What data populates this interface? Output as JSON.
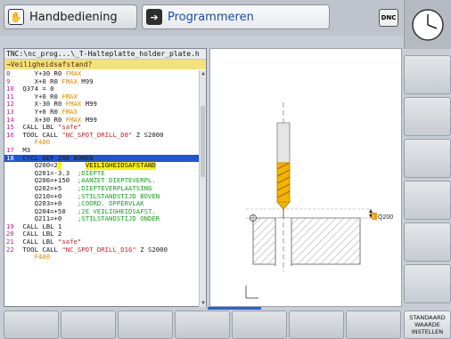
{
  "header": {
    "mode_machine_label": "Handbediening",
    "mode_programming_label": "Programmeren",
    "dnc_label": "DNC"
  },
  "program": {
    "path": "TNC:\\nc_prog...\\_T-Halteplatte_holder_plate.h",
    "hint": "→Veiligheidsafstand?",
    "lines": [
      {
        "n": "8",
        "parts": [
          {
            "t": "    Y+30 R0 ",
            "c": "kw"
          },
          {
            "t": "FMAX",
            "c": "feed"
          }
        ]
      },
      {
        "n": "9",
        "parts": [
          {
            "t": "    X+0 R0 ",
            "c": "kw"
          },
          {
            "t": "FMAX",
            "c": "feed"
          },
          {
            "t": " M99",
            "c": "kw"
          }
        ]
      },
      {
        "n": "10",
        "parts": [
          {
            "t": " Q374 = 0",
            "c": "kw"
          }
        ]
      },
      {
        "n": "11",
        "parts": [
          {
            "t": "    Y+0 R0 ",
            "c": "kw"
          },
          {
            "t": "FMAX",
            "c": "feed"
          }
        ]
      },
      {
        "n": "12",
        "parts": [
          {
            "t": "    X-30 R0 ",
            "c": "kw"
          },
          {
            "t": "FMAX",
            "c": "feed"
          },
          {
            "t": " M99",
            "c": "kw"
          }
        ]
      },
      {
        "n": "13",
        "parts": [
          {
            "t": "    Y+0 R0 ",
            "c": "kw"
          },
          {
            "t": "FMAX",
            "c": "feed"
          }
        ]
      },
      {
        "n": "14",
        "parts": [
          {
            "t": "    X+30 R0 ",
            "c": "kw"
          },
          {
            "t": "FMAX",
            "c": "feed"
          },
          {
            "t": " M99",
            "c": "kw"
          }
        ]
      },
      {
        "n": "15",
        "parts": [
          {
            "t": " CALL LBL ",
            "c": "kw"
          },
          {
            "t": "\"safe\"",
            "c": "str"
          }
        ]
      },
      {
        "n": "16",
        "parts": [
          {
            "t": " TOOL CALL ",
            "c": "kw"
          },
          {
            "t": "\"NC_SPOT_DRILL_D8\"",
            "c": "str"
          },
          {
            "t": " Z S2000",
            "c": "kw"
          }
        ]
      },
      {
        "n": "",
        "parts": [
          {
            "t": "    F400",
            "c": "feed"
          }
        ]
      },
      {
        "n": "17",
        "parts": [
          {
            "t": " M3",
            "c": "kw"
          }
        ]
      },
      {
        "n": "18",
        "sel": true,
        "parts": [
          {
            "t": " CYCL DEF 200 BOREN",
            "c": "kw"
          }
        ]
      },
      {
        "n": "",
        "parts": [
          {
            "t": "    Q200=2",
            "c": "kw"
          },
          {
            "t": " ",
            "c": "hl"
          },
          {
            "t": "      ",
            "c": "kw"
          },
          {
            "t": "VEILIGHEIDSAFSTAND",
            "c": "hl"
          }
        ]
      },
      {
        "n": "",
        "parts": [
          {
            "t": "    Q201=-3.3  ",
            "c": "kw"
          },
          {
            "t": ";DIEPTE",
            "c": "com"
          }
        ]
      },
      {
        "n": "",
        "parts": [
          {
            "t": "    Q206=+150  ",
            "c": "kw"
          },
          {
            "t": ";AANZET DIEPTEVERPL.",
            "c": "com"
          }
        ]
      },
      {
        "n": "",
        "parts": [
          {
            "t": "    Q202=+5    ",
            "c": "kw"
          },
          {
            "t": ";DIEPTEVERPLAATSING",
            "c": "com"
          }
        ]
      },
      {
        "n": "",
        "parts": [
          {
            "t": "    Q210=+0    ",
            "c": "kw"
          },
          {
            "t": ";STILSTANDSTIJD BOVEN",
            "c": "com"
          }
        ]
      },
      {
        "n": "",
        "parts": [
          {
            "t": "    Q203=+0    ",
            "c": "kw"
          },
          {
            "t": ";COORD. OPPERVLAK",
            "c": "com"
          }
        ]
      },
      {
        "n": "",
        "parts": [
          {
            "t": "    Q204=+50   ",
            "c": "kw"
          },
          {
            "t": ";2E VEILIGHEIDSAFST.",
            "c": "com"
          }
        ]
      },
      {
        "n": "",
        "parts": [
          {
            "t": "    Q211=+0    ",
            "c": "kw"
          },
          {
            "t": ";STILSTANDSTIJD ONDER",
            "c": "com"
          }
        ]
      },
      {
        "n": "19",
        "parts": [
          {
            "t": " CALL LBL 1",
            "c": "kw"
          }
        ]
      },
      {
        "n": "20",
        "parts": [
          {
            "t": " CALL LBL 2",
            "c": "kw"
          }
        ]
      },
      {
        "n": "21",
        "parts": [
          {
            "t": " CALL LBL ",
            "c": "kw"
          },
          {
            "t": "\"safe\"",
            "c": "str"
          }
        ]
      },
      {
        "n": "22",
        "parts": [
          {
            "t": " TOOL CALL ",
            "c": "kw"
          },
          {
            "t": "\"NC_SPOT_DRILL_D16\"",
            "c": "str"
          },
          {
            "t": " Z S2000",
            "c": "kw"
          }
        ]
      },
      {
        "n": "",
        "parts": [
          {
            "t": "    F400",
            "c": "feed"
          }
        ]
      }
    ]
  },
  "graphic": {
    "param_label": "Q200"
  },
  "softkeys": {
    "bottom_last_label": "STANDAARD WAARDE INSTELLEN"
  },
  "colors": {
    "selection": "#1f55d4",
    "hint_bar": "#f3e27c",
    "feed": "#e08a00",
    "string": "#c22",
    "comment": "#17a024",
    "highlight": "#fff200"
  }
}
